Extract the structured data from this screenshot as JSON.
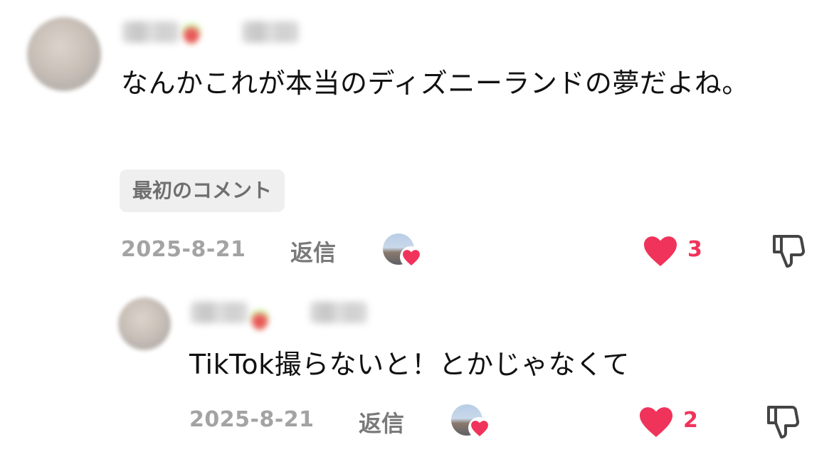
{
  "comments": [
    {
      "text": "なんかこれが本当のディズニーランドの夢だよね。",
      "badge": "最初のコメント",
      "date": "2025-8-21",
      "reply_label": "返信",
      "like_count": "3"
    },
    {
      "text": "TikTok撮らないと！とかじゃなくて",
      "date": "2025-8-21",
      "reply_label": "返信",
      "like_count": "2"
    }
  ],
  "colors": {
    "like_red": "#f0335a",
    "date_gray": "#a3a3a3",
    "reply_gray": "#7a7a7a",
    "badge_bg": "#efefef"
  },
  "icons": [
    "heart-icon",
    "thumbs-down-icon",
    "creator-liked-heart-icon"
  ]
}
